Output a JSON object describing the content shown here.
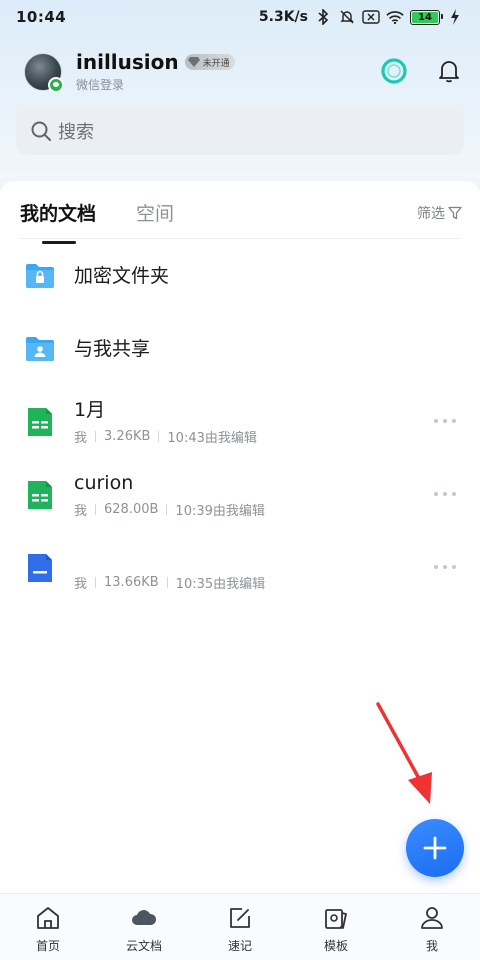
{
  "status_bar": {
    "time": "10:44",
    "speed": "5.3K/s",
    "battery": "14"
  },
  "profile": {
    "username": "inillusion",
    "vip_label": "未开通",
    "login_method": "微信登录"
  },
  "search": {
    "placeholder": "搜索"
  },
  "tabs": [
    {
      "label": "我的文档",
      "active": true
    },
    {
      "label": "空间",
      "active": false
    }
  ],
  "filter_label": "筛选",
  "items": [
    {
      "title": "加密文件夹",
      "type": "lock-folder"
    },
    {
      "title": "与我共享",
      "type": "shared-folder"
    },
    {
      "title": "1月",
      "type": "sheet",
      "owner": "我",
      "size": "3.26KB",
      "edited": "10:43由我编辑"
    },
    {
      "title": "curion",
      "type": "sheet",
      "owner": "我",
      "size": "628.00B",
      "edited": "10:39由我编辑"
    },
    {
      "title": "",
      "type": "doc",
      "owner": "我",
      "size": "13.66KB",
      "edited": "10:35由我编辑"
    }
  ],
  "colors": {
    "accent_blue": "#1a6df0",
    "folder_blue": "#3aa7f0",
    "sheet_green": "#1fb35a",
    "doc_blue": "#2f6ee8",
    "arrow_red": "#f03232"
  },
  "bottom_nav": [
    {
      "label": "首页",
      "icon": "home-icon"
    },
    {
      "label": "云文档",
      "icon": "cloud-icon"
    },
    {
      "label": "速记",
      "icon": "note-icon"
    },
    {
      "label": "模板",
      "icon": "template-icon"
    },
    {
      "label": "我",
      "icon": "user-icon"
    }
  ]
}
